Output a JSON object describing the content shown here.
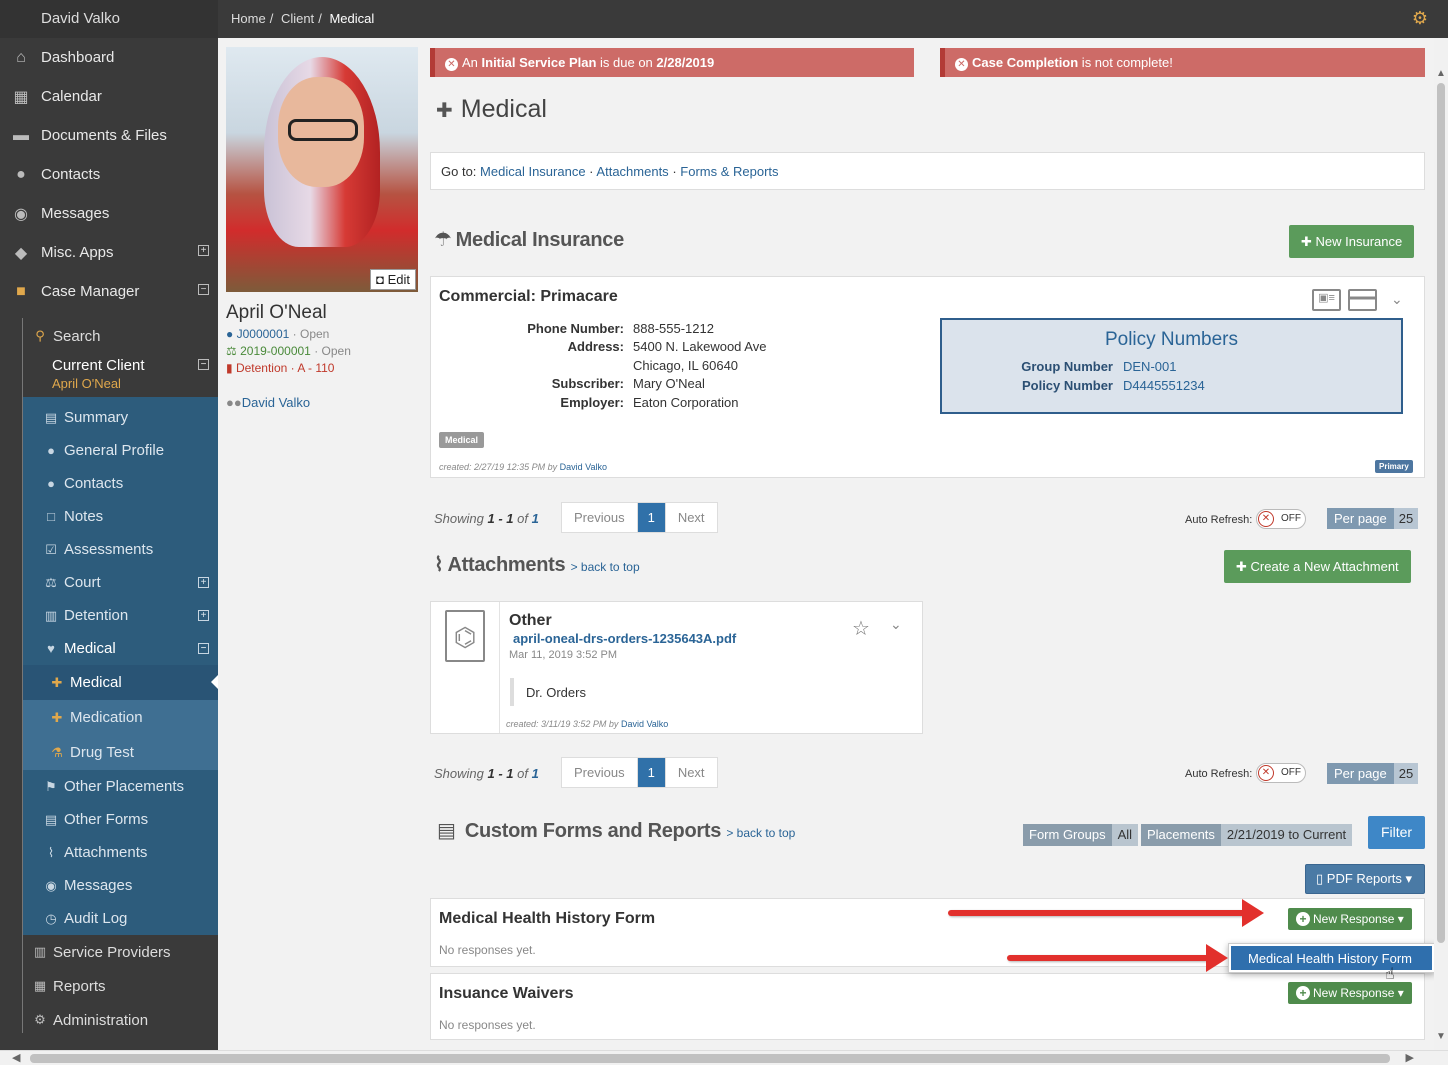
{
  "user": {
    "name": "David Valko"
  },
  "breadcrumb": [
    "Home",
    "Client",
    "Medical"
  ],
  "sidebar": {
    "main": [
      {
        "label": "Dashboard",
        "icon": "home-icon"
      },
      {
        "label": "Calendar",
        "icon": "calendar-icon"
      },
      {
        "label": "Documents & Files",
        "icon": "folder-icon"
      },
      {
        "label": "Contacts",
        "icon": "users-icon"
      },
      {
        "label": "Messages",
        "icon": "comments-icon"
      },
      {
        "label": "Misc. Apps",
        "icon": "cubes-icon"
      },
      {
        "label": "Case Manager",
        "icon": "briefcase-icon"
      }
    ],
    "search_label": "Search",
    "current_client_label": "Current Client",
    "current_client_name": "April O'Neal",
    "client_items": [
      "Summary",
      "General Profile",
      "Contacts",
      "Notes",
      "Assessments",
      "Court",
      "Detention",
      "Medical"
    ],
    "medical_items": [
      "Medical",
      "Medication",
      "Drug Test"
    ],
    "other_items": [
      "Other Placements",
      "Other Forms",
      "Attachments",
      "Messages",
      "Audit Log"
    ],
    "bottom_items": [
      "Service Providers",
      "Reports",
      "Administration"
    ]
  },
  "profile": {
    "edit_label": "Edit",
    "name": "April O'Neal",
    "case1_id": "J0000001",
    "case1_status": "· Open",
    "case2_id": "2019-000001",
    "case2_status": "· Open",
    "detention": "Detention · A - 110",
    "staff": "David Valko"
  },
  "alerts": {
    "a1_pre": "An ",
    "a1_bold": "Initial Service Plan",
    "a1_mid": " is due on ",
    "a1_date": "2/28/2019",
    "a2_bold": "Case Completion",
    "a2_post": " is not complete!"
  },
  "page": {
    "title": "Medical",
    "goto_label": "Go to:",
    "goto_links": [
      "Medical Insurance",
      "Attachments",
      "Forms & Reports"
    ],
    "sep": "·"
  },
  "insurance": {
    "heading": "Medical Insurance",
    "new_button": "New Insurance",
    "card_title": "Commercial: Primacare",
    "phone_label": "Phone Number:",
    "phone": "888-555-1212",
    "address_label": "Address:",
    "address1": "5400 N. Lakewood Ave",
    "address2": "Chicago, IL 60640",
    "subscriber_label": "Subscriber:",
    "subscriber": "Mary O'Neal",
    "employer_label": "Employer:",
    "employer": "Eaton Corporation",
    "policy_heading": "Policy Numbers",
    "group_label": "Group Number",
    "group": "DEN-001",
    "policy_label": "Policy Number",
    "policy": "D4445551234",
    "tag": "Medical",
    "created_pre": "created:",
    "created": "2/27/19 12:35 PM by",
    "created_by": "David Valko",
    "primary": "Primary"
  },
  "pagination": {
    "showing": "Showing",
    "range_start": "1",
    "range_sep": " - ",
    "range_end": "1",
    "of": " of ",
    "total": "1",
    "prev": "Previous",
    "page": "1",
    "next": "Next",
    "auto_refresh": "Auto Refresh:",
    "off": "OFF",
    "per_page": "Per page",
    "per_page_value": "25"
  },
  "attachments": {
    "heading": "Attachments",
    "back_to_top": "> back to top",
    "create_button": "Create a New Attachment",
    "type": "Other",
    "filename": "april-oneal-drs-orders-1235643A.pdf",
    "date": "Mar 11, 2019 3:52 PM",
    "note": "Dr. Orders",
    "created_pre": "created:",
    "created": "3/11/19 3:52 PM by",
    "created_by": "David Valko"
  },
  "forms": {
    "heading": "Custom Forms and Reports",
    "back_to_top": "> back to top",
    "groups_label": "Form Groups",
    "groups_value": "All",
    "placements_label": "Placements",
    "placements_value": "2/21/2019 to Current",
    "filter": "Filter",
    "pdf_reports": "PDF Reports",
    "items": [
      {
        "title": "Medical Health History Form",
        "status": "No responses yet.",
        "button": "New Response"
      },
      {
        "title": "Insuance Waivers",
        "status": "No responses yet.",
        "button": "New Response"
      }
    ],
    "dropdown_item": "Medical Health History Form"
  },
  "colors": {
    "accent_orange": "#e0a84c",
    "sidebar_blue": "#2d5c7c",
    "alert_red": "#cd6b67",
    "green": "#5b9b5b",
    "link_blue": "#2a6496"
  }
}
